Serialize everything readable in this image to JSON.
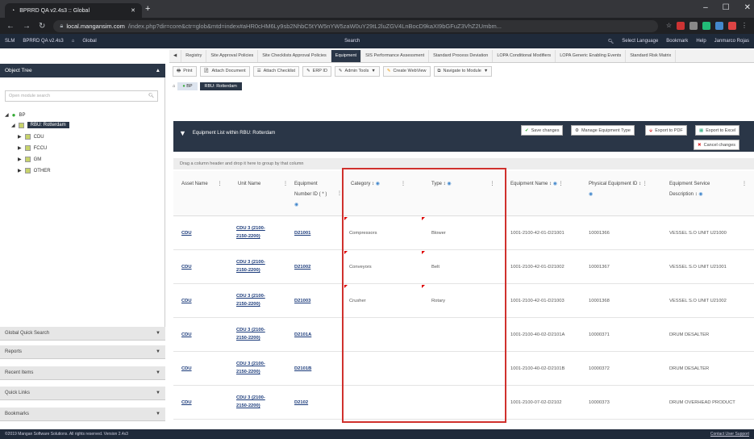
{
  "browser": {
    "tab_title": "BPRRD QA v2.4s3 :: Global",
    "url_host": "local.mangansim.com",
    "url_rest": "/index.php?dir=core&ctr=glob&mtd=index#aHR0cHM6Ly9sb2NhbC5tYW5nYW5zaW0uY29tL2luZGV4LnBocD9kaXI9bGFuZ3VhZ2Umbm...",
    "minimize": "–",
    "maximize": "☐",
    "close": "✕"
  },
  "appnav": {
    "items": [
      "SLM",
      "BPRRD QA v2.4s3",
      "Global"
    ],
    "search": "Search",
    "select_language": "Select Language",
    "bookmark": "Bookmark",
    "help": "Help",
    "user": "Janmarco Rojas"
  },
  "left": {
    "header": "Object Tree",
    "search_placeholder": "Open module search",
    "root": "BP",
    "selected": "RBU: Rotterdam",
    "children": [
      "CDU",
      "FCCU",
      "GM",
      "OTHER"
    ],
    "accordions": [
      "Global Quick Search",
      "Reports",
      "Recent Items",
      "Quick Links",
      "Bookmarks"
    ]
  },
  "tabs": [
    "Registry",
    "Site Approval Policies",
    "Site Checklists Approval Policies",
    "Equipment",
    "SIS Performance Assessment",
    "Standard Process Deviation",
    "LOPA Conditional Modifiers",
    "LOPA Generic Enabling Events",
    "Standard Risk Matrix"
  ],
  "toolbar": [
    "Print",
    "Attach Document",
    "Attach Checklist",
    "ERP ID",
    "Admin Tools",
    "Create WebView",
    "Navigate to Module"
  ],
  "breadcrumb": [
    "BP",
    "RBU: Rotterdam"
  ],
  "grid": {
    "title": "Equipment List within RBU: Rotterdam",
    "buttons": [
      "Save changes",
      "Manage Equipment Type",
      "Export to PDF",
      "Export to Excel",
      "Cancel changes"
    ],
    "group_hint": "Drag a column header and drop it here to group by that column",
    "columns": [
      "Asset Name",
      "Unit Name",
      "Equipment Number ID ( * )",
      "Category",
      "Type",
      "Equipment Name",
      "Physical Equipment ID",
      "Equipment Service Description"
    ],
    "rows": [
      {
        "asset": "CDU",
        "unit": "CDU 3 (2100-2150-2200)",
        "num": "D21001",
        "cat": "Compressors",
        "type": "Blower",
        "name": "1001-2100-42-01-D21001",
        "pid": "10001366",
        "desc": "VESSEL S.O UNIT U21000"
      },
      {
        "asset": "CDU",
        "unit": "CDU 3 (2100-2150-2200)",
        "num": "D21002",
        "cat": "Conveyors",
        "type": "Belt",
        "name": "1001-2100-42-01-D21002",
        "pid": "10001367",
        "desc": "VESSEL S.O UNIT U21001"
      },
      {
        "asset": "CDU",
        "unit": "CDU 3 (2100-2150-2200)",
        "num": "D21003",
        "cat": "Crusher",
        "type": "Rotary",
        "name": "1001-2100-42-01-D21003",
        "pid": "10001368",
        "desc": "VESSEL S.O UNIT U21002"
      },
      {
        "asset": "CDU",
        "unit": "CDU 3 (2100-2150-2200)",
        "num": "D2101A",
        "cat": "",
        "type": "",
        "name": "1001-2100-40-02-D2101A",
        "pid": "10000371",
        "desc": "DRUM DESALTER"
      },
      {
        "asset": "CDU",
        "unit": "CDU 3 (2100-2150-2200)",
        "num": "D2101B",
        "cat": "",
        "type": "",
        "name": "1001-2100-40-02-D2101B",
        "pid": "10000372",
        "desc": "DRUM DESALTER"
      },
      {
        "asset": "CDU",
        "unit": "CDU 3 (2100-2150-2200)",
        "num": "D2102",
        "cat": "",
        "type": "",
        "name": "1001-2100-07-02-D2102",
        "pid": "10000373",
        "desc": "DRUM OVERHEAD PRODUCT"
      }
    ]
  },
  "footer": {
    "left": "©2019 Mangan Software Solutions. All rights reserved. Version 2.4s3",
    "right": "Contact User Support"
  }
}
